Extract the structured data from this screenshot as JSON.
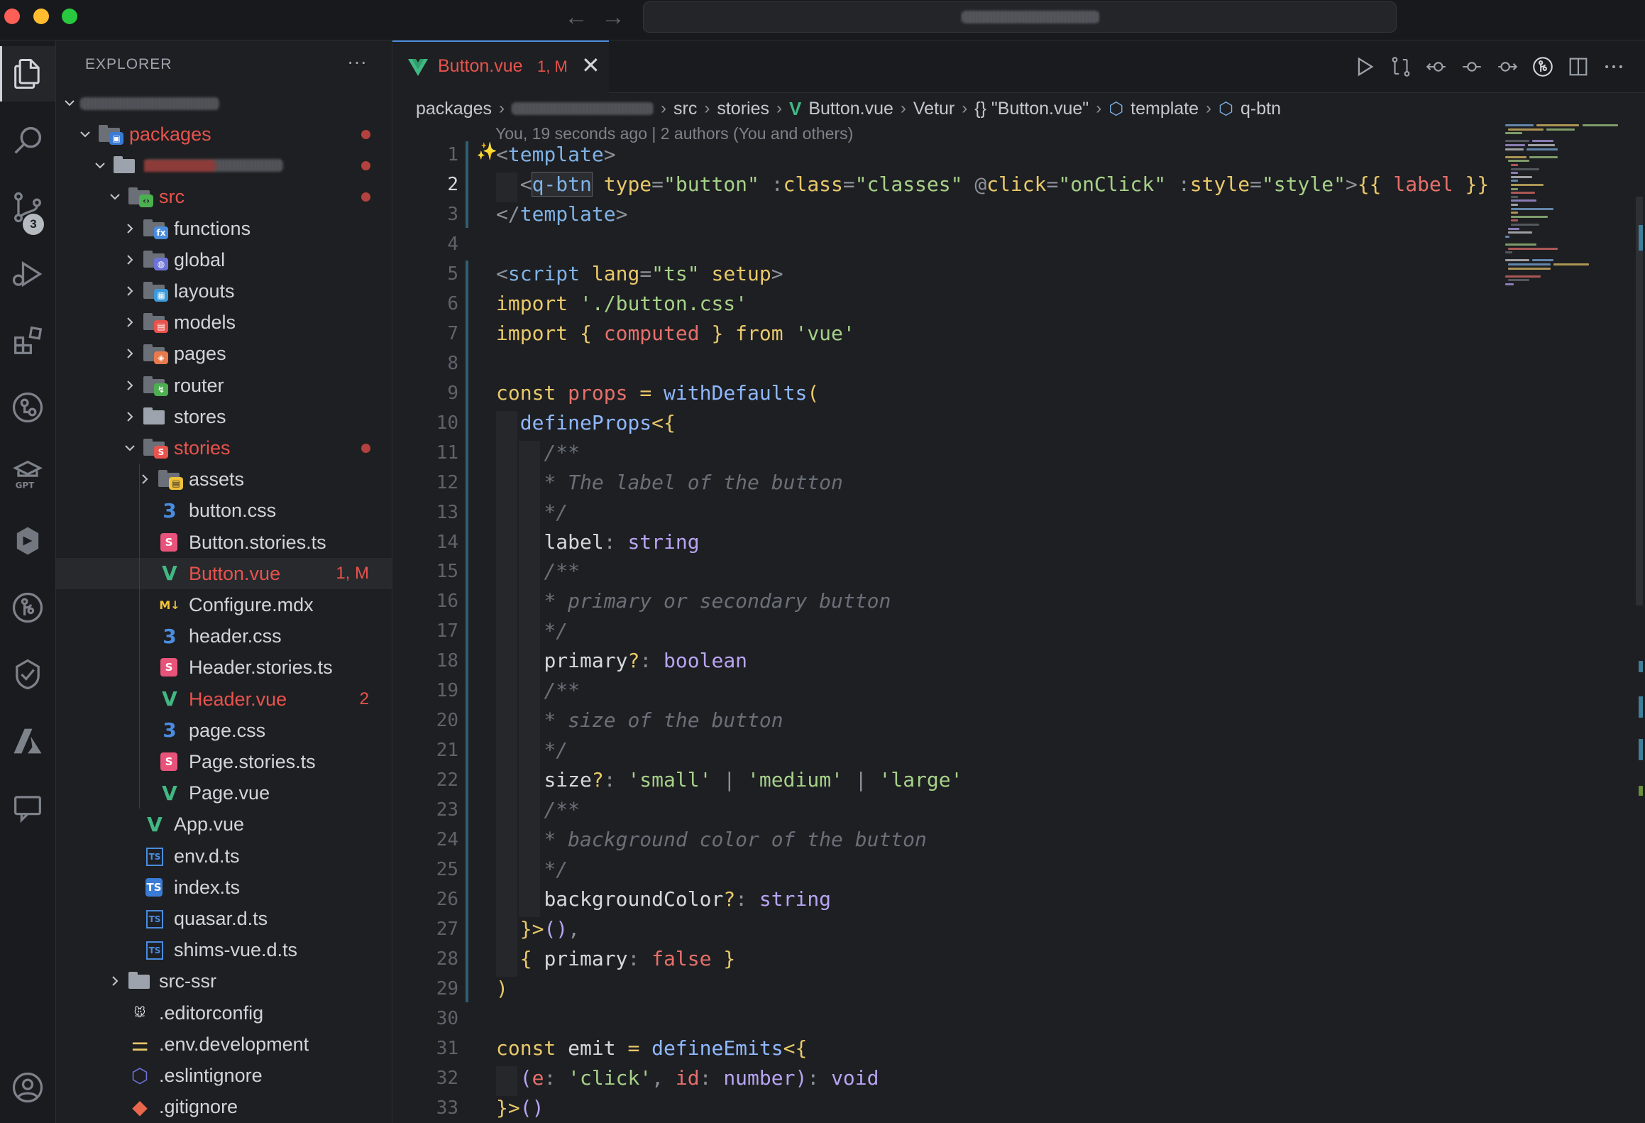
{
  "window": {
    "title": "████████████",
    "colors": {
      "close": "#fe5f57",
      "minimize": "#febc2e",
      "zoom": "#28c840"
    }
  },
  "activity_bar": {
    "items": [
      {
        "name": "explorer-icon",
        "active": true
      },
      {
        "name": "search-icon"
      },
      {
        "name": "source-control-icon",
        "badge": "3"
      },
      {
        "name": "run-debug-icon"
      },
      {
        "name": "extensions-icon"
      },
      {
        "name": "git-graph-icon"
      },
      {
        "name": "gpt-icon",
        "label": "GPT"
      },
      {
        "name": "remote-icon"
      },
      {
        "name": "gitlens-icon"
      },
      {
        "name": "testing-icon"
      },
      {
        "name": "azure-icon"
      },
      {
        "name": "comments-icon"
      },
      {
        "name": "accounts-icon"
      }
    ]
  },
  "explorer": {
    "title": "EXPLORER",
    "more": "···",
    "root": "███████████",
    "items": [
      {
        "label": "packages",
        "indent": 1,
        "expanded": true,
        "kind": "folder-packages",
        "modified": true,
        "color": "#e8534d"
      },
      {
        "label": "██████████s",
        "indent": 2,
        "expanded": true,
        "kind": "folder-open",
        "modified": true,
        "color": "#e8534d"
      },
      {
        "label": "src",
        "indent": 3,
        "expanded": true,
        "kind": "folder-src",
        "modified": true,
        "color": "#e8534d"
      },
      {
        "label": "functions",
        "indent": 4,
        "expanded": false,
        "kind": "folder-functions"
      },
      {
        "label": "global",
        "indent": 4,
        "expanded": false,
        "kind": "folder-global"
      },
      {
        "label": "layouts",
        "indent": 4,
        "expanded": false,
        "kind": "folder-layouts"
      },
      {
        "label": "models",
        "indent": 4,
        "expanded": false,
        "kind": "folder-models"
      },
      {
        "label": "pages",
        "indent": 4,
        "expanded": false,
        "kind": "folder-pages"
      },
      {
        "label": "router",
        "indent": 4,
        "expanded": false,
        "kind": "folder-router"
      },
      {
        "label": "stores",
        "indent": 4,
        "expanded": false,
        "kind": "folder"
      },
      {
        "label": "stories",
        "indent": 4,
        "expanded": true,
        "kind": "folder-stories",
        "modified": true,
        "color": "#e8534d"
      },
      {
        "label": "assets",
        "indent": 5,
        "expanded": false,
        "kind": "folder-assets"
      },
      {
        "label": "button.css",
        "indent": 5,
        "kind": "css"
      },
      {
        "label": "Button.stories.ts",
        "indent": 5,
        "kind": "storybook"
      },
      {
        "label": "Button.vue",
        "indent": 5,
        "kind": "vue",
        "status": "1, M",
        "color": "#e8534d",
        "selected": true
      },
      {
        "label": "Configure.mdx",
        "indent": 5,
        "kind": "mdx"
      },
      {
        "label": "header.css",
        "indent": 5,
        "kind": "css"
      },
      {
        "label": "Header.stories.ts",
        "indent": 5,
        "kind": "storybook"
      },
      {
        "label": "Header.vue",
        "indent": 5,
        "kind": "vue",
        "status": "2",
        "color": "#e8534d"
      },
      {
        "label": "page.css",
        "indent": 5,
        "kind": "css"
      },
      {
        "label": "Page.stories.ts",
        "indent": 5,
        "kind": "storybook"
      },
      {
        "label": "Page.vue",
        "indent": 5,
        "kind": "vue"
      },
      {
        "label": "App.vue",
        "indent": 4,
        "kind": "vue"
      },
      {
        "label": "env.d.ts",
        "indent": 4,
        "kind": "ts"
      },
      {
        "label": "index.ts",
        "indent": 4,
        "kind": "ts-solid"
      },
      {
        "label": "quasar.d.ts",
        "indent": 4,
        "kind": "ts"
      },
      {
        "label": "shims-vue.d.ts",
        "indent": 4,
        "kind": "ts"
      },
      {
        "label": "src-ssr",
        "indent": 3,
        "expanded": false,
        "kind": "folder"
      },
      {
        "label": ".editorconfig",
        "indent": 3,
        "kind": "editorconfig"
      },
      {
        "label": ".env.development",
        "indent": 3,
        "kind": "env"
      },
      {
        "label": ".eslintignore",
        "indent": 3,
        "kind": "eslint"
      },
      {
        "label": ".gitignore",
        "indent": 3,
        "kind": "git"
      }
    ]
  },
  "tab": {
    "title": "Button.vue",
    "status": "1, M",
    "close": "✕"
  },
  "breadcrumb": [
    {
      "label": "packages"
    },
    {
      "label": "f██████████s",
      "blurred": true
    },
    {
      "label": "src"
    },
    {
      "label": "stories"
    },
    {
      "label": "Button.vue",
      "icon": "vue"
    },
    {
      "label": "Vetur"
    },
    {
      "label": "{} \"Button.vue\""
    },
    {
      "label": "template",
      "icon": "cube"
    },
    {
      "label": "q-btn",
      "icon": "cube"
    }
  ],
  "blame": "You, 19 seconds ago | 2 authors (You and others)",
  "code": {
    "current_line": 2,
    "lines": [
      {
        "n": "1",
        "t": [
          [
            "br",
            "<"
          ],
          [
            "tag",
            "template"
          ],
          [
            "br",
            ">"
          ]
        ]
      },
      {
        "n": "2",
        "t": [
          [
            "def",
            "  "
          ],
          [
            "br",
            "<"
          ],
          [
            "tag",
            "q-btn"
          ],
          [
            "def",
            " "
          ],
          [
            "attr",
            "type"
          ],
          [
            "op",
            "="
          ],
          [
            "str",
            "\"button\""
          ],
          [
            "def",
            " "
          ],
          [
            "op",
            ":"
          ],
          [
            "attr",
            "class"
          ],
          [
            "op",
            "="
          ],
          [
            "str",
            "\"classes\""
          ],
          [
            "def",
            " "
          ],
          [
            "op",
            "@"
          ],
          [
            "attr",
            "click"
          ],
          [
            "op",
            "="
          ],
          [
            "str",
            "\"onClick\""
          ],
          [
            "def",
            " "
          ],
          [
            "op",
            ":"
          ],
          [
            "attr",
            "style"
          ],
          [
            "op",
            "="
          ],
          [
            "str",
            "\"style\""
          ],
          [
            "br",
            ">"
          ],
          [
            "attr",
            "{{ "
          ],
          [
            "var",
            "label"
          ],
          [
            "attr",
            " }}"
          ]
        ]
      },
      {
        "n": "3",
        "t": [
          [
            "br",
            "</"
          ],
          [
            "tag",
            "template"
          ],
          [
            "br",
            ">"
          ]
        ]
      },
      {
        "n": "4",
        "t": []
      },
      {
        "n": "5",
        "t": [
          [
            "br",
            "<"
          ],
          [
            "tag",
            "script"
          ],
          [
            "def",
            " "
          ],
          [
            "attr",
            "lang"
          ],
          [
            "op",
            "="
          ],
          [
            "str",
            "\"ts\""
          ],
          [
            "def",
            " "
          ],
          [
            "attr",
            "setup"
          ],
          [
            "br",
            ">"
          ]
        ]
      },
      {
        "n": "6",
        "t": [
          [
            "imp",
            "import"
          ],
          [
            "def",
            " "
          ],
          [
            "str",
            "'./button.css'"
          ]
        ]
      },
      {
        "n": "7",
        "t": [
          [
            "imp",
            "import"
          ],
          [
            "def",
            " "
          ],
          [
            "kw",
            "{ "
          ],
          [
            "var",
            "computed"
          ],
          [
            "kw",
            " }"
          ],
          [
            "def",
            " "
          ],
          [
            "imp",
            "from"
          ],
          [
            "def",
            " "
          ],
          [
            "str",
            "'vue'"
          ]
        ]
      },
      {
        "n": "8",
        "t": []
      },
      {
        "n": "9",
        "t": [
          [
            "kw",
            "const"
          ],
          [
            "def",
            " "
          ],
          [
            "var",
            "props"
          ],
          [
            "def",
            " "
          ],
          [
            "kw",
            "="
          ],
          [
            "def",
            " "
          ],
          [
            "fn",
            "withDefaults"
          ],
          [
            "kw",
            "("
          ]
        ]
      },
      {
        "n": "10",
        "t": [
          [
            "def",
            "  "
          ],
          [
            "fn",
            "defineProps"
          ],
          [
            "kw",
            "<{"
          ]
        ]
      },
      {
        "n": "11",
        "t": [
          [
            "def",
            "    "
          ],
          [
            "cm",
            "/**"
          ]
        ]
      },
      {
        "n": "12",
        "t": [
          [
            "def",
            "    "
          ],
          [
            "cm",
            "* The label of the button"
          ]
        ]
      },
      {
        "n": "13",
        "t": [
          [
            "def",
            "    "
          ],
          [
            "cm",
            "*/"
          ]
        ]
      },
      {
        "n": "14",
        "t": [
          [
            "def",
            "    "
          ],
          [
            "def",
            "label"
          ],
          [
            "op",
            ": "
          ],
          [
            "ty",
            "string"
          ]
        ]
      },
      {
        "n": "15",
        "t": [
          [
            "def",
            "    "
          ],
          [
            "cm",
            "/**"
          ]
        ]
      },
      {
        "n": "16",
        "t": [
          [
            "def",
            "    "
          ],
          [
            "cm",
            "* primary or secondary button"
          ]
        ]
      },
      {
        "n": "17",
        "t": [
          [
            "def",
            "    "
          ],
          [
            "cm",
            "*/"
          ]
        ]
      },
      {
        "n": "18",
        "t": [
          [
            "def",
            "    "
          ],
          [
            "def",
            "primary"
          ],
          [
            "kw",
            "?"
          ],
          [
            "op",
            ": "
          ],
          [
            "ty",
            "boolean"
          ]
        ]
      },
      {
        "n": "19",
        "t": [
          [
            "def",
            "    "
          ],
          [
            "cm",
            "/**"
          ]
        ]
      },
      {
        "n": "20",
        "t": [
          [
            "def",
            "    "
          ],
          [
            "cm",
            "* size of the button"
          ]
        ]
      },
      {
        "n": "21",
        "t": [
          [
            "def",
            "    "
          ],
          [
            "cm",
            "*/"
          ]
        ]
      },
      {
        "n": "22",
        "t": [
          [
            "def",
            "    "
          ],
          [
            "def",
            "size"
          ],
          [
            "kw",
            "?"
          ],
          [
            "op",
            ": "
          ],
          [
            "str",
            "'small'"
          ],
          [
            "op",
            " | "
          ],
          [
            "str",
            "'medium'"
          ],
          [
            "op",
            " | "
          ],
          [
            "str",
            "'large'"
          ]
        ]
      },
      {
        "n": "23",
        "t": [
          [
            "def",
            "    "
          ],
          [
            "cm",
            "/**"
          ]
        ]
      },
      {
        "n": "24",
        "t": [
          [
            "def",
            "    "
          ],
          [
            "cm",
            "* background color of the button"
          ]
        ]
      },
      {
        "n": "25",
        "t": [
          [
            "def",
            "    "
          ],
          [
            "cm",
            "*/"
          ]
        ]
      },
      {
        "n": "26",
        "t": [
          [
            "def",
            "    "
          ],
          [
            "def",
            "backgroundColor"
          ],
          [
            "kw",
            "?"
          ],
          [
            "op",
            ": "
          ],
          [
            "ty",
            "string"
          ]
        ]
      },
      {
        "n": "27",
        "t": [
          [
            "def",
            "  "
          ],
          [
            "kw",
            "}>"
          ],
          [
            "ty",
            "()"
          ],
          [
            "op",
            ","
          ]
        ]
      },
      {
        "n": "28",
        "t": [
          [
            "def",
            "  "
          ],
          [
            "kw",
            "{ "
          ],
          [
            "def",
            "primary"
          ],
          [
            "op",
            ": "
          ],
          [
            "var",
            "false"
          ],
          [
            "kw",
            " }"
          ]
        ]
      },
      {
        "n": "29",
        "t": [
          [
            "kw",
            ")"
          ]
        ]
      },
      {
        "n": "30",
        "t": []
      },
      {
        "n": "31",
        "t": [
          [
            "kw",
            "const"
          ],
          [
            "def",
            " "
          ],
          [
            "def",
            "emit"
          ],
          [
            "def",
            " "
          ],
          [
            "kw",
            "="
          ],
          [
            "def",
            " "
          ],
          [
            "fn",
            "defineEmits"
          ],
          [
            "kw",
            "<{"
          ]
        ]
      },
      {
        "n": "32",
        "t": [
          [
            "def",
            "  "
          ],
          [
            "ty",
            "("
          ],
          [
            "var",
            "e"
          ],
          [
            "op",
            ": "
          ],
          [
            "str",
            "'click'"
          ],
          [
            "op",
            ", "
          ],
          [
            "var",
            "id"
          ],
          [
            "op",
            ": "
          ],
          [
            "ty",
            "number"
          ],
          [
            "ty",
            ")"
          ],
          [
            "op",
            ": "
          ],
          [
            "ty",
            "void"
          ]
        ]
      },
      {
        "n": "33",
        "t": [
          [
            "kw",
            "}>"
          ],
          [
            "ty",
            "()"
          ]
        ]
      }
    ]
  }
}
